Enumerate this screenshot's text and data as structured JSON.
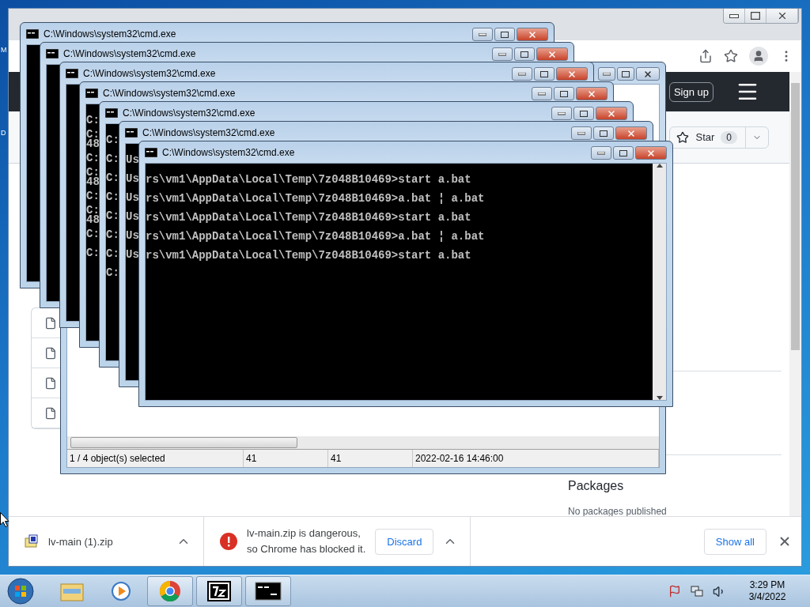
{
  "desktop": {
    "icon_labels": [
      "M",
      "D"
    ]
  },
  "browser": {
    "header": {
      "sign_up": "Sign up"
    },
    "repo": {
      "star_label": "Star",
      "star_count": "0"
    },
    "sidebar": {
      "packages_title": "Packages",
      "packages_text": "No packages published"
    },
    "downloads": [
      {
        "kind": "file",
        "name": "lv-main (1).zip"
      },
      {
        "kind": "blocked",
        "message": "lv-main.zip is dangerous,\nso Chrome has blocked it.",
        "action": "Discard"
      }
    ],
    "show_all": "Show all"
  },
  "archive_window": {
    "status": [
      "1 / 4 object(s) selected",
      "41",
      "41",
      "2022-02-16 14:46:00"
    ]
  },
  "consoles": [
    {
      "title": "C:\\Windows\\system32\\cmd.exe"
    },
    {
      "title": "C:\\Windows\\system32\\cmd.exe"
    },
    {
      "title": "C:\\Windows\\system32\\cmd.exe"
    },
    {
      "title": "C:\\Windows\\system32\\cmd.exe",
      "lines": [
        "C:",
        "C:\n48",
        "C:",
        "C:\n48",
        "C:",
        "C:\n48",
        "C:",
        "C:"
      ]
    },
    {
      "title": "C:\\Windows\\system32\\cmd.exe",
      "lines": [
        "C:",
        "C:",
        "C:",
        "C:",
        "C:",
        "C:",
        "C:",
        "C:"
      ]
    },
    {
      "title": "C:\\Windows\\system32\\cmd.exe",
      "lines": [
        "Us",
        "Us",
        "Us",
        "Us",
        "Us",
        "Us"
      ]
    },
    {
      "title": "C:\\Windows\\system32\\cmd.exe",
      "lines": [
        "rs\\vm1\\AppData\\Local\\Temp\\7z048B10469>start a.bat",
        "rs\\vm1\\AppData\\Local\\Temp\\7z048B10469>a.bat ¦ a.bat",
        "rs\\vm1\\AppData\\Local\\Temp\\7z048B10469>start a.bat",
        "rs\\vm1\\AppData\\Local\\Temp\\7z048B10469>a.bat ¦ a.bat",
        "rs\\vm1\\AppData\\Local\\Temp\\7z048B10469>start a.bat"
      ]
    }
  ],
  "taskbar": {
    "time": "3:29 PM",
    "date": "3/4/2022"
  }
}
